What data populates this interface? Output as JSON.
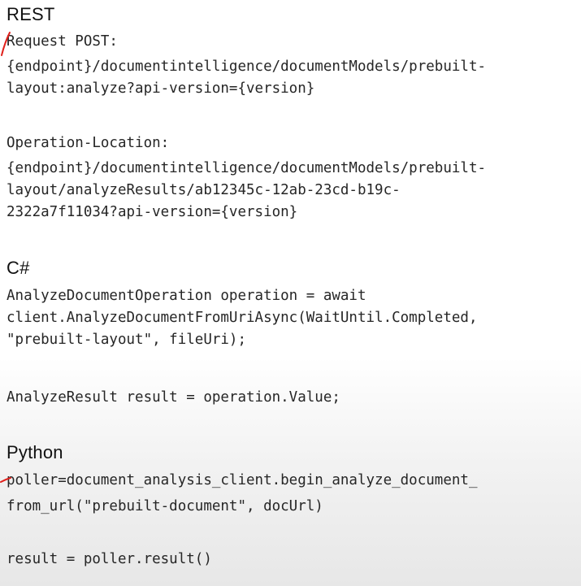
{
  "sections": {
    "rest": {
      "heading": "REST",
      "request_label": "Request POST:",
      "request_line1": "{endpoint}/documentintelligence/documentModels/prebuilt-",
      "request_line2": "layout:analyze?api-version={version}",
      "operation_label": "Operation-Location:",
      "operation_line1": "{endpoint}/documentintelligence/documentModels/prebuilt-",
      "operation_line2": "layout/analyzeResults/ab12345c-12ab-23cd-b19c-",
      "operation_line3": "2322a7f11034?api-version={version}"
    },
    "csharp": {
      "heading": "C#",
      "line1": "AnalyzeDocumentOperation operation = await",
      "line2": "client.AnalyzeDocumentFromUriAsync(WaitUntil.Completed,",
      "line3": "\"prebuilt-layout\", fileUri);",
      "line4": "AnalyzeResult result = operation.Value;"
    },
    "python": {
      "heading": "Python",
      "line1": "poller=document_analysis_client.begin_analyze_document_",
      "line2": "from_url(\"prebuilt-document\", docUrl)",
      "line3": "result = poller.result()"
    }
  },
  "annotation_color": "#e0201b"
}
